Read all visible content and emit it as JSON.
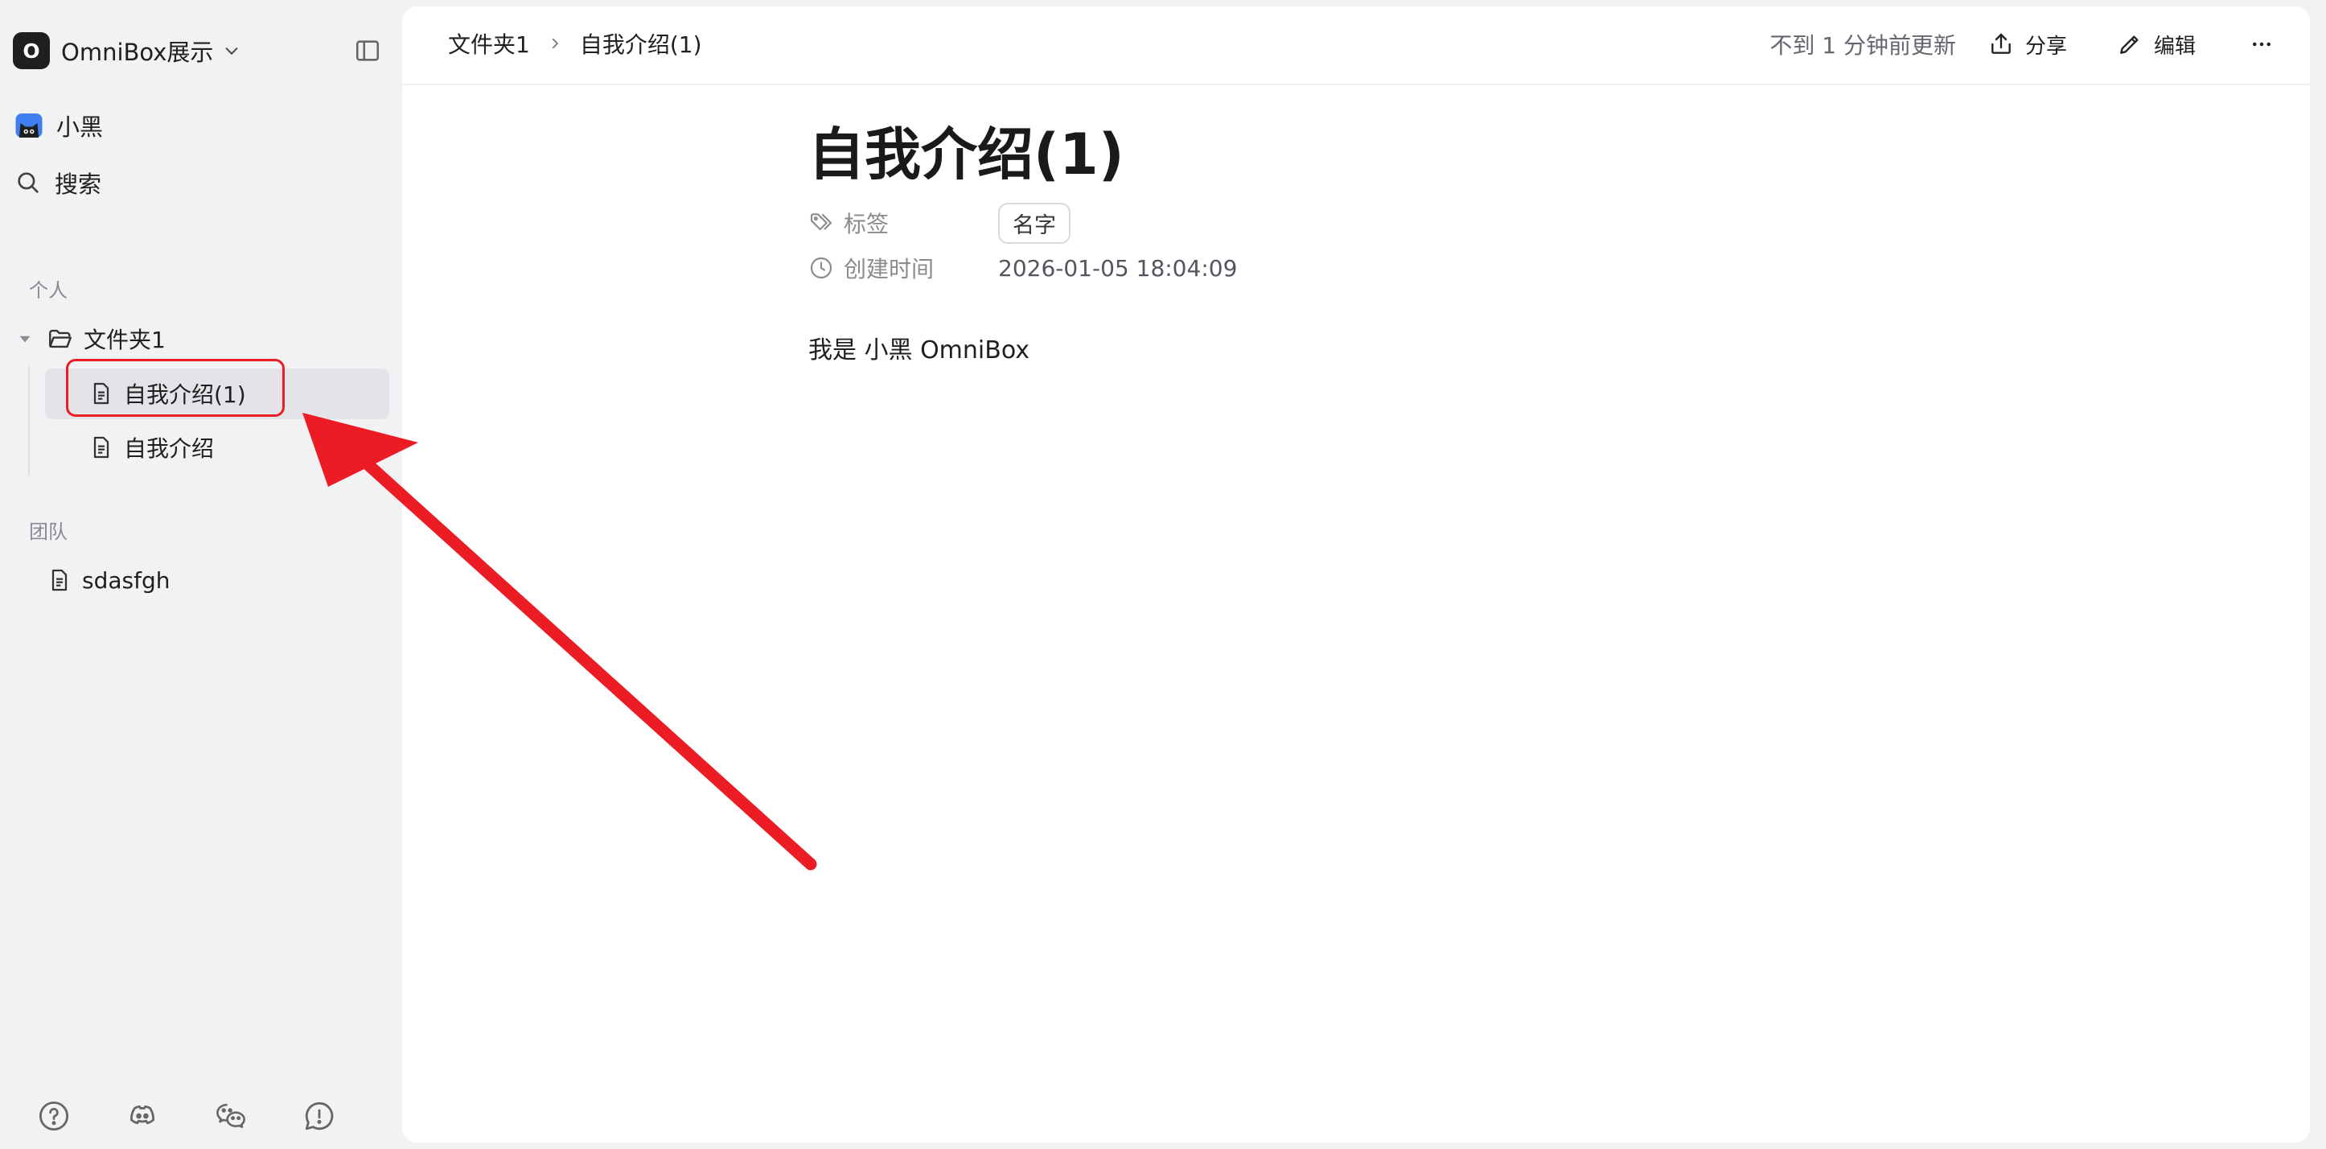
{
  "workspace": {
    "avatar_letter": "O",
    "name": "OmniBox展示"
  },
  "nav": {
    "user_name": "小黑",
    "search_label": "搜索"
  },
  "sections": {
    "personal": "个人",
    "team": "团队"
  },
  "tree": {
    "folder": "文件夹1",
    "docs": [
      "自我介绍(1)",
      "自我介绍"
    ],
    "team_docs": [
      "sdasfgh"
    ]
  },
  "header": {
    "breadcrumb": [
      "文件夹1",
      "自我介绍(1)"
    ],
    "updated": "不到 1 分钟前更新",
    "share_label": "分享",
    "edit_label": "编辑"
  },
  "document": {
    "title": "自我介绍(1)",
    "props": {
      "tags_label": "标签",
      "tag_value": "名字",
      "created_label": "创建时间",
      "created_value": "2026-01-05 18:04:09"
    },
    "body": "我是 小黑 OmniBox"
  },
  "colors": {
    "annotation": "#ec1c24",
    "sidebar_bg": "#f2f2f5",
    "selected_bg": "#e3e3e8"
  }
}
